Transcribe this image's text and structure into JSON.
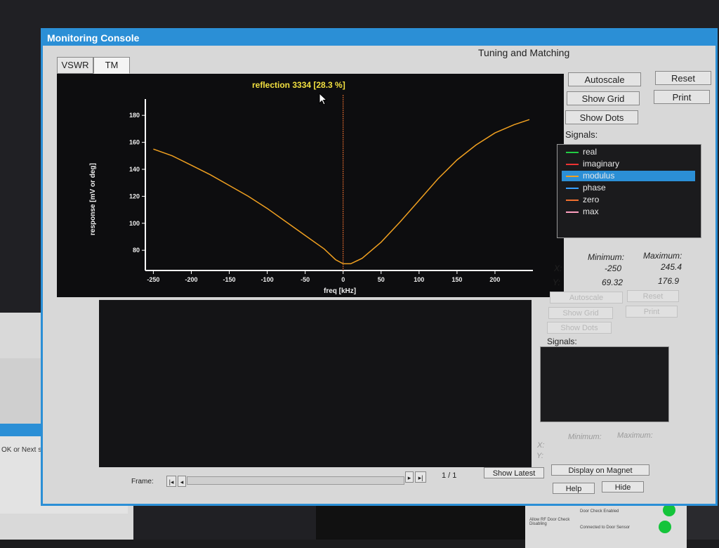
{
  "window": {
    "title": "Monitoring Console",
    "subtitle": "Tuning and Matching",
    "tabs": [
      {
        "label": "VSWR",
        "active": false
      },
      {
        "label": "TM",
        "active": true
      }
    ]
  },
  "plot_top": {
    "annotation": "reflection 3334 [28.3 %]",
    "xlabel": "freq [kHz]",
    "ylabel": "response [mV or deg]"
  },
  "buttons_top": {
    "autoscale": "Autoscale",
    "reset": "Reset",
    "show_grid": "Show Grid",
    "print": "Print",
    "show_dots": "Show Dots"
  },
  "signals_label": "Signals:",
  "signals": [
    {
      "name": "real",
      "color": "#22cc44",
      "selected": false
    },
    {
      "name": "imaginary",
      "color": "#e33",
      "selected": false
    },
    {
      "name": "modulus",
      "color": "#f0a020",
      "selected": true
    },
    {
      "name": "phase",
      "color": "#38a0ff",
      "selected": false
    },
    {
      "name": "zero",
      "color": "#f07030",
      "selected": false
    },
    {
      "name": "max",
      "color": "#ff9fc0",
      "selected": false
    }
  ],
  "stats": {
    "min_label": "Minimum:",
    "max_label": "Maximum:",
    "x_label": "X:",
    "y_label": "Y:",
    "x_min": "-250",
    "x_max": "245.4",
    "y_min": "69.32",
    "y_max": "176.9"
  },
  "buttons_bottom": {
    "autoscale": "Autoscale",
    "reset": "Reset",
    "show_grid": "Show Grid",
    "print": "Print",
    "show_dots": "Show Dots"
  },
  "signals2_label": "Signals:",
  "stats2": {
    "min_label": "Minimum:",
    "max_label": "Maximum:",
    "x_label": "X:",
    "y_label": "Y:"
  },
  "footer": {
    "frame_label": "Frame:",
    "frame_counter": "1 / 1",
    "show_latest": "Show Latest",
    "display_on_magnet": "Display on Magnet",
    "help": "Help",
    "hide": "Hide"
  },
  "background": {
    "dialog_message": "OK or Next scan to continue",
    "dialog_ok": "OK",
    "rf_door": "Allow RF Door Check Disabling",
    "door_check": "Door Check Enabled",
    "door_sensor": "Connected to Door Sensor"
  },
  "chart_data": {
    "type": "line",
    "xlabel": "freq [kHz]",
    "ylabel": "response [mV or deg]",
    "xlim": [
      -250,
      245.4
    ],
    "ylim": [
      69.32,
      176.9
    ],
    "xticks": [
      -250,
      -200,
      -150,
      -100,
      -50,
      0,
      50,
      100,
      150,
      200
    ],
    "yticks": [
      80,
      100,
      120,
      140,
      160,
      180
    ],
    "marker_x": 0,
    "series": [
      {
        "name": "modulus",
        "color": "#f0a020",
        "x": [
          -250,
          -225,
          -200,
          -175,
          -150,
          -125,
          -100,
          -75,
          -50,
          -25,
          -10,
          0,
          10,
          25,
          50,
          75,
          100,
          125,
          150,
          175,
          200,
          225,
          245.4
        ],
        "y": [
          155,
          150,
          143,
          136,
          128,
          120,
          111,
          101,
          91,
          81,
          73,
          70,
          70,
          74,
          86,
          101,
          117,
          133,
          147,
          158,
          167,
          173,
          176.9
        ]
      }
    ]
  }
}
